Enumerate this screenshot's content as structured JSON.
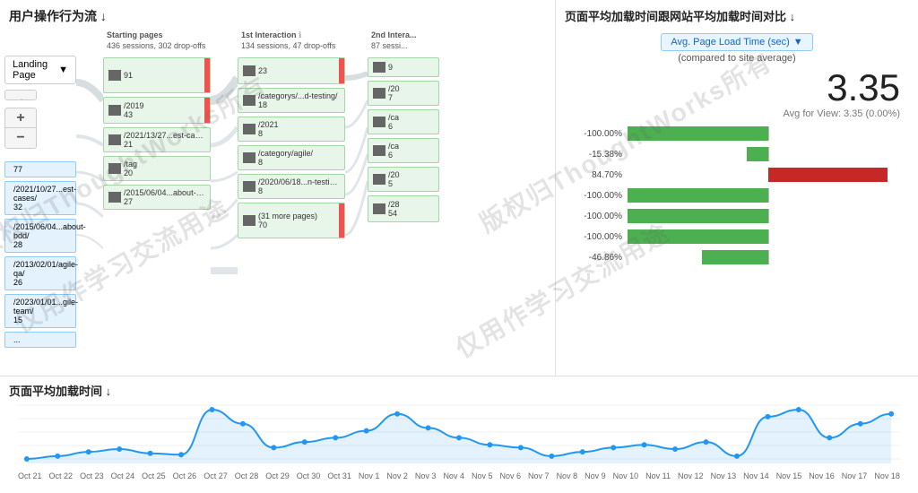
{
  "leftTitle": "用户操作行为流 ↓",
  "rightTitle": "页面平均加载时间跟网站平均加载时间对比 ↓",
  "bottomTitle": "页面平均加载时间 ↓",
  "landingDropdown": "Landing Page",
  "metricDropdown": "Avg. Page Load Time (sec)",
  "metricSubtitle": "(compared to site average)",
  "bigNumber": "3.35",
  "avgLabel": "Avg for View: 3.35 (0.00%)",
  "startingPagesHeader": "Starting pages",
  "startingPagesSessions": "436 sessions, 302 drop-offs",
  "firstInteractionHeader": "1st Interaction",
  "firstInteractionSessions": "134 sessions, 47 drop-offs",
  "secondInteractionHeader": "2nd Intera...",
  "secondInteractionSessions": "87 sessi...",
  "landingNodes": [
    {
      "label": "77"
    },
    {
      "label": "/2021/10/27...est-cases/\n32"
    },
    {
      "label": "/2015/06/04...about-bdd/\n28"
    },
    {
      "label": "/2013/02/01/agile-qa/\n26"
    },
    {
      "label": "/2023/01/01...gile-team/\n15"
    },
    {
      "label": "...\n..."
    }
  ],
  "startingNodes": [
    {
      "label": "91",
      "size": "large"
    },
    {
      "label": "/2019\n43",
      "size": "medium"
    },
    {
      "label": "/2021/13/27...est-cases/\n21",
      "size": "small"
    },
    {
      "label": "/tag\n20",
      "size": "small"
    },
    {
      "label": "/2015/06/04...about-bdd/\n27",
      "size": "small"
    }
  ],
  "firstInteractionNodes": [
    {
      "label": "23",
      "size": "medium"
    },
    {
      "label": "/categorys/...d-testing/\n18",
      "size": "small"
    },
    {
      "label": "/2021\n8",
      "size": "small"
    },
    {
      "label": "/category/agile/\n8",
      "size": "small"
    },
    {
      "label": "/2020/06/18...n-testing/\n8",
      "size": "small"
    },
    {
      "label": "(31 more pages)\n70",
      "size": "large"
    }
  ],
  "secondInteractionNodes": [
    {
      "label": "9"
    },
    {
      "label": "/20\n7"
    },
    {
      "label": "/ca\n6"
    },
    {
      "label": "/ca\n6"
    },
    {
      "label": "/20\n5"
    },
    {
      "label": "/28\n54"
    }
  ],
  "bars": [
    {
      "label": "-100.00%",
      "value": -100,
      "percent": 100
    },
    {
      "label": "-15.38%",
      "value": -15.38,
      "percent": 15.38
    },
    {
      "label": "84.70%",
      "value": 84.7,
      "percent": 84.7,
      "positive": true
    },
    {
      "label": "-100.00%",
      "value": -100,
      "percent": 100
    },
    {
      "label": "-100.00%",
      "value": -100,
      "percent": 100
    },
    {
      "label": "-100.00%",
      "value": -100,
      "percent": 100
    },
    {
      "label": "-46.86%",
      "value": -46.86,
      "percent": 46.86
    }
  ],
  "xLabels": [
    "Oct 21",
    "Oct 22",
    "Oct 23",
    "Oct 24",
    "Oct 25",
    "Oct 26",
    "Oct 27",
    "Oct 28",
    "Oct 29",
    "Oct 30",
    "Oct 31",
    "Nov 1",
    "Nov 2",
    "Nov 3",
    "Nov 4",
    "Nov 5",
    "Nov 6",
    "Nov 7",
    "Nov 8",
    "Nov 9",
    "Nov 10",
    "Nov 11",
    "Nov 12",
    "Nov 13",
    "Nov 14",
    "Nov 15",
    "Nov 16",
    "Nov 17",
    "Nov 18"
  ],
  "chartPoints": [
    20,
    22,
    25,
    27,
    24,
    23,
    55,
    45,
    28,
    32,
    35,
    40,
    52,
    42,
    35,
    30,
    28,
    22,
    25,
    28,
    30,
    27,
    32,
    22,
    50,
    55,
    35,
    45,
    52
  ],
  "watermarkLines": [
    "版权归ThoughtWorks所有",
    "仅用作学习交流用途",
    "版权归ThoughtWorks所有",
    "仅用作学习交流用途"
  ]
}
